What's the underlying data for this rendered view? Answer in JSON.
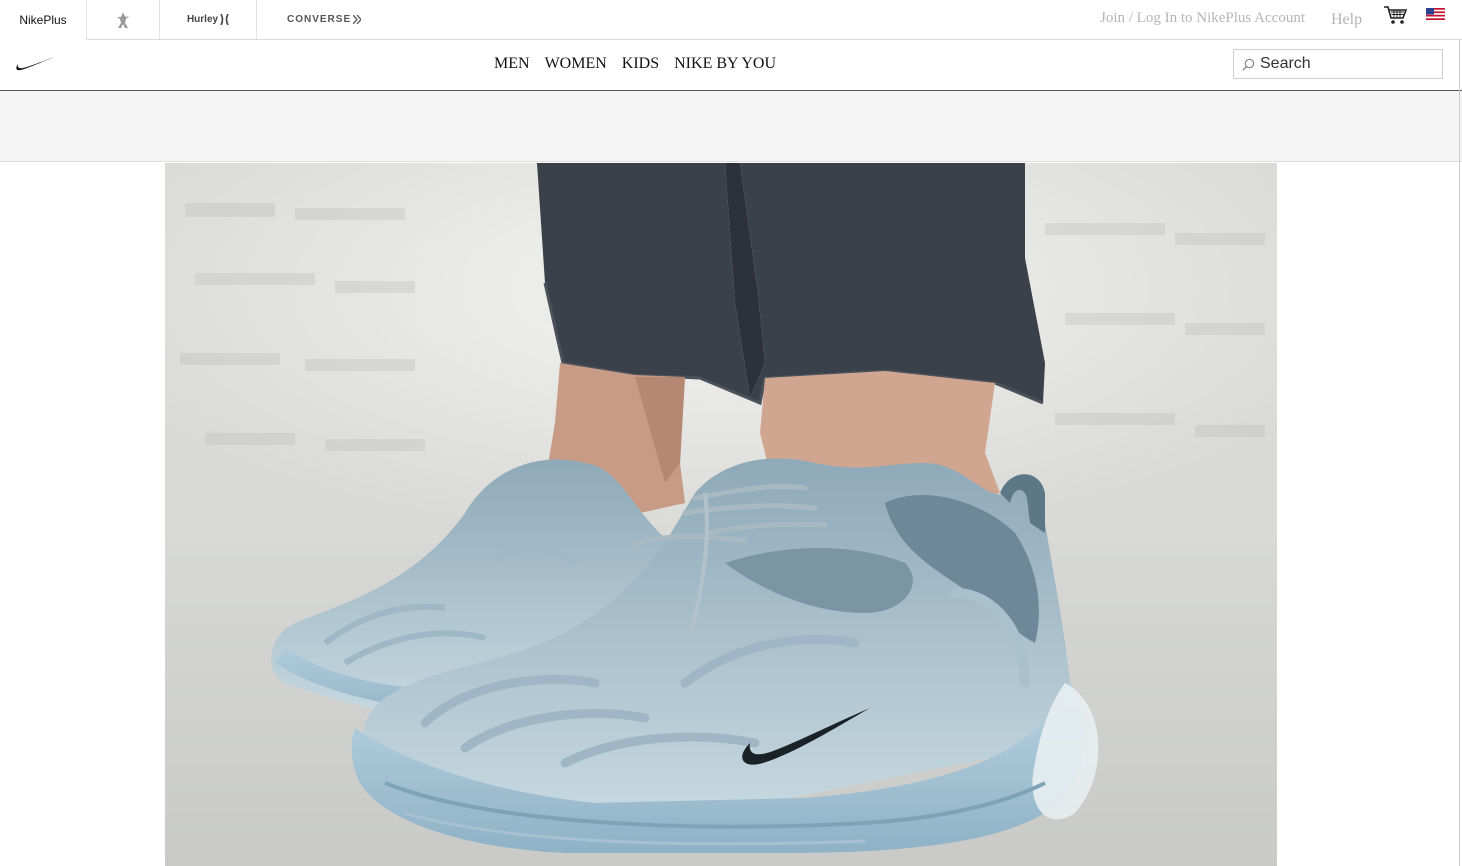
{
  "topbar": {
    "brands": [
      {
        "label": "NikePlus"
      },
      {
        "label": ""
      },
      {
        "label": "Hurley"
      },
      {
        "label": "CONVERSE"
      }
    ],
    "account_label": "Join / Log In to NikePlus Account",
    "help_label": "Help",
    "cart_icon": "shopping-cart-icon",
    "flag_icon": "us-flag-icon"
  },
  "nav": {
    "logo_icon": "nike-swoosh-icon",
    "items": [
      {
        "label": "MEN"
      },
      {
        "label": "WOMEN"
      },
      {
        "label": "KIDS"
      },
      {
        "label": "NIKE BY YOU"
      }
    ],
    "search": {
      "placeholder": "Search",
      "icon": "search-icon"
    }
  },
  "hero": {
    "image": "sneaker-photo",
    "colors": {
      "background": "#e9e9e7",
      "shoe": "#8fb1c4",
      "jeans": "#3a4049"
    }
  }
}
